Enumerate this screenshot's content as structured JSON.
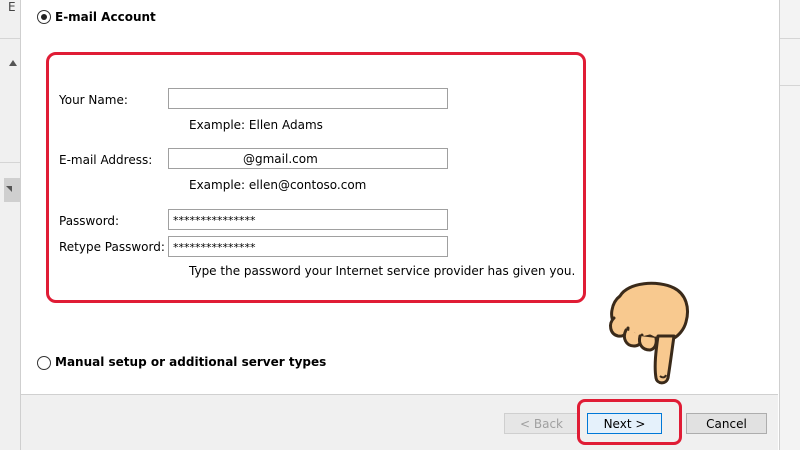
{
  "background": {
    "left_title_fragment": "E"
  },
  "options": {
    "email_account_label": "E-mail Account",
    "manual_setup_label": "Manual setup or additional server types",
    "selected": "email_account"
  },
  "form": {
    "your_name": {
      "label": "Your Name:",
      "value": "",
      "example": "Example: Ellen Adams"
    },
    "email": {
      "label": "E-mail Address:",
      "value": "@gmail.com",
      "example": "Example: ellen@contoso.com"
    },
    "password": {
      "label": "Password:",
      "value": "***************"
    },
    "retype_password": {
      "label": "Retype Password:",
      "value": "***************"
    },
    "password_hint": "Type the password your Internet service provider has given you."
  },
  "buttons": {
    "back": "< Back",
    "next": "Next >",
    "cancel": "Cancel"
  },
  "colors": {
    "highlight": "#e01c35",
    "hand_skin": "#f8c98f",
    "hand_outline": "#3a2a1a"
  },
  "icons": {
    "pointer": "pointing-hand-icon"
  }
}
